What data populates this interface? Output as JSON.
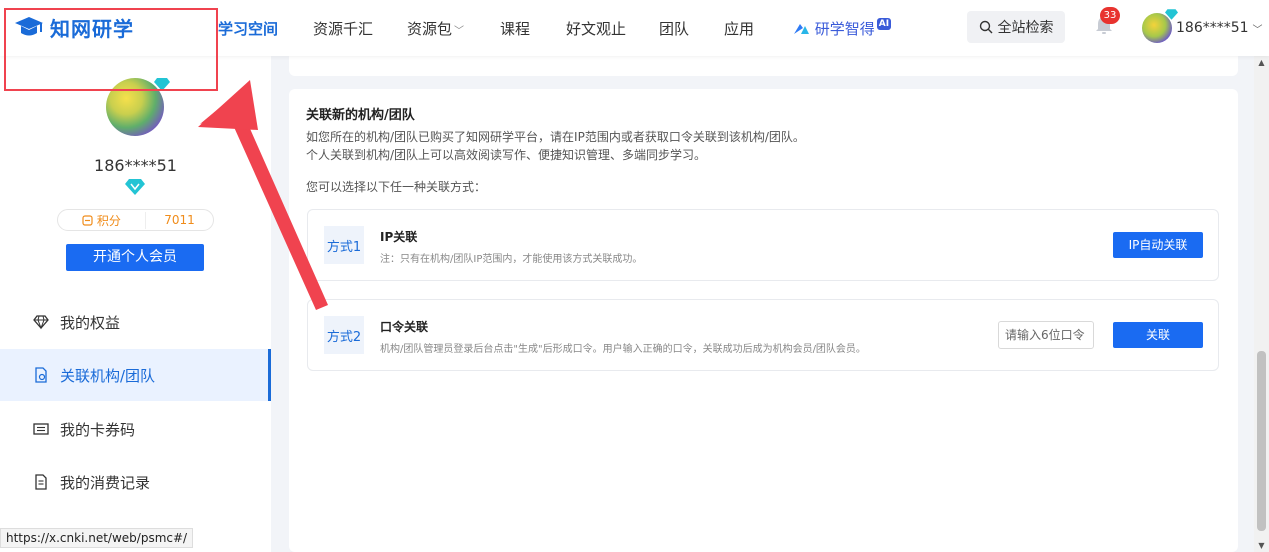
{
  "brand": {
    "name": "知网研学"
  },
  "nav": {
    "items": [
      {
        "label": "学习空间",
        "active": true
      },
      {
        "label": "资源千汇"
      },
      {
        "label": "资源包",
        "caret": "﹀"
      },
      {
        "label": "课程"
      },
      {
        "label": "好文观止"
      },
      {
        "label": "团队"
      },
      {
        "label": "应用"
      },
      {
        "label": "研学智得",
        "badge": "AI"
      }
    ],
    "search_label": "全站检索",
    "notification_count": "33",
    "username": "186****51",
    "user_caret": "﹀"
  },
  "sidebar": {
    "name": "186****51",
    "points_label": "积分",
    "points_value": "7011",
    "vip_button": "开通个人会员",
    "menu": [
      {
        "label": "我的权益",
        "icon": "diamond-outline-icon"
      },
      {
        "label": "关联机构/团队",
        "icon": "link-document-icon",
        "active": true
      },
      {
        "label": "我的卡券码",
        "icon": "ticket-icon"
      },
      {
        "label": "我的消费记录",
        "icon": "receipt-icon"
      }
    ]
  },
  "status_url": "https://x.cnki.net/web/psmc#/",
  "main": {
    "title": "关联新的机构/团队",
    "desc1": "如您所在的机构/团队已购买了知网研学平台，请在IP范围内或者获取口令关联到该机构/团队。",
    "desc2": "个人关联到机构/团队上可以高效阅读写作、便捷知识管理、多端同步学习。",
    "choose_text": "您可以选择以下任一种关联方式：",
    "option1": {
      "tag": "方式1",
      "title": "IP关联",
      "note": "注：只有在机构/团队IP范围内，才能使用该方式关联成功。",
      "button": "IP自动关联"
    },
    "option2": {
      "tag": "方式2",
      "title": "口令关联",
      "note": "机构/团队管理员登录后台点击\"生成\"后形成口令。用户输入正确的口令，关联成功后成为机构会员/团队会员。",
      "placeholder": "请输入6位口令",
      "button": "关联"
    }
  },
  "colors": {
    "accent": "#1a6bd8",
    "button": "#1a6bf2",
    "annotation": "#f0434f",
    "badge": "#e8332f"
  }
}
